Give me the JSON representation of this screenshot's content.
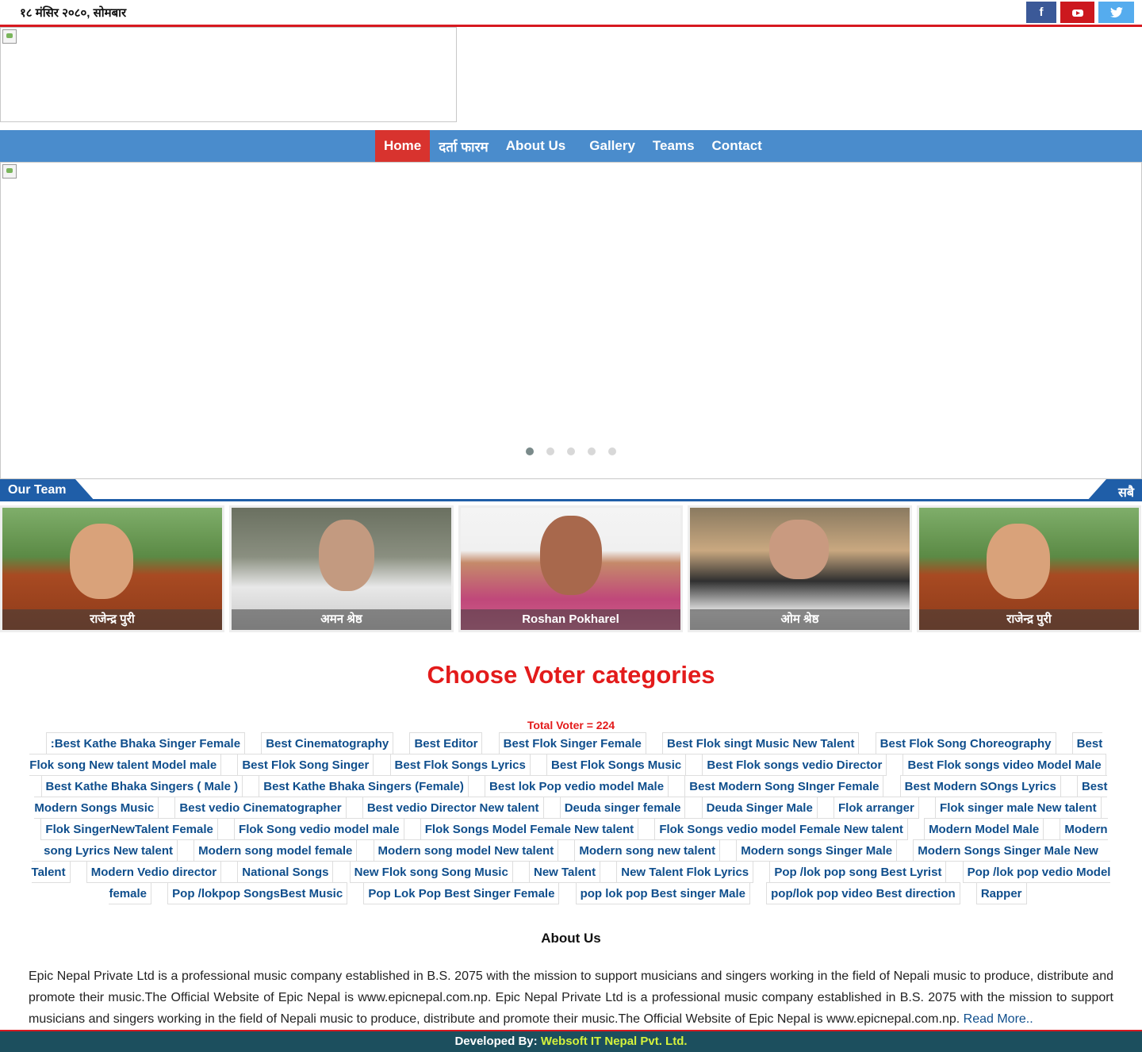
{
  "topbar": {
    "date": "१८ मंसिर २०८०, सोमबार",
    "social": [
      {
        "name": "facebook-icon",
        "glyph": "f"
      },
      {
        "name": "youtube-icon",
        "glyph": "You▶"
      },
      {
        "name": "twitter-icon",
        "glyph": "🐦"
      }
    ]
  },
  "nav": {
    "items": [
      "Home",
      "दर्ता फारम",
      "About Us",
      "Gallery",
      "Teams",
      "Contact"
    ],
    "active_index": 0
  },
  "slider": {
    "slide_count": 5,
    "active_slide": 1
  },
  "team_section": {
    "title": "Our Team",
    "all_label": "सबै",
    "members": [
      "राजेन्द्र पुरी",
      "अमन श्रेष्ठ",
      "Roshan Pokharel",
      "ओम श्रेष्ठ",
      "राजेन्द्र पुरी"
    ]
  },
  "voter": {
    "title": "Choose Voter categories",
    "total": "Total Voter = 224",
    "categories": [
      ":Best Kathe Bhaka Singer Female",
      "Best Cinematography",
      "Best Editor",
      "Best Flok Singer Female",
      "Best Flok singt Music New Talent",
      "Best Flok Song Choreography",
      "Best Flok song New talent Model male",
      "Best Flok Song Singer",
      "Best Flok Songs Lyrics",
      "Best Flok Songs Music",
      "Best Flok songs vedio Director",
      "Best Flok songs video Model Male",
      "Best Kathe Bhaka Singers ( Male )",
      "Best Kathe Bhaka Singers (Female)",
      "Best lok Pop vedio model Male",
      "Best Modern Song SInger Female",
      "Best Modern SOngs Lyrics",
      "Best Modern Songs Music",
      "Best vedio Cinematographer",
      "Best vedio Director New talent",
      "Deuda singer female",
      "Deuda Singer Male",
      "Flok arranger",
      "Flok singer male New talent",
      "Flok SingerNewTalent Female",
      "Flok Song vedio model male",
      "Flok Songs Model Female New talent",
      "Flok Songs vedio model Female New talent",
      "Modern Model Male",
      "Modern song Lyrics New talent",
      "Modern song model female",
      "Modern song model New talent",
      "Modern song new talent",
      "Modern songs Singer Male",
      "Modern Songs Singer Male New Talent",
      "Modern Vedio director",
      "National Songs",
      "New Flok song Song Music",
      "New Talent",
      "New Talent Flok Lyrics",
      "Pop /lok pop song Best Lyrist",
      "Pop /lok pop vedio Model female",
      "Pop /lokpop SongsBest Music",
      "Pop Lok Pop Best Singer Female",
      "pop lok pop Best singer Male",
      "pop/lok pop video Best direction",
      "Rapper"
    ]
  },
  "about": {
    "title": "About Us",
    "body": "Epic Nepal Private Ltd is a professional music company established in B.S. 2075 with the mission to support musicians and singers working in the field of Nepali music to produce, distribute and promote their music.The Official Website of Epic Nepal is www.epicnepal.com.np. Epic Nepal Private Ltd is a professional music company established in B.S. 2075 with the mission to support musicians and singers working in the field of Nepali music to produce, distribute and promote their music.The Official Website of Epic Nepal is www.epicnepal.com.np.",
    "read_more": "Read More.."
  },
  "footer": {
    "prefix": "Developed By:",
    "company": "Websoft IT Nepal Pvt. Ltd."
  },
  "colors": {
    "accent_red": "#d71920",
    "nav_blue": "#4a8ccc",
    "team_blue": "#1f5ea8",
    "link_blue": "#0f4e8c",
    "footer_bg": "#1c4f5e",
    "footer_company": "#d4f23c"
  }
}
